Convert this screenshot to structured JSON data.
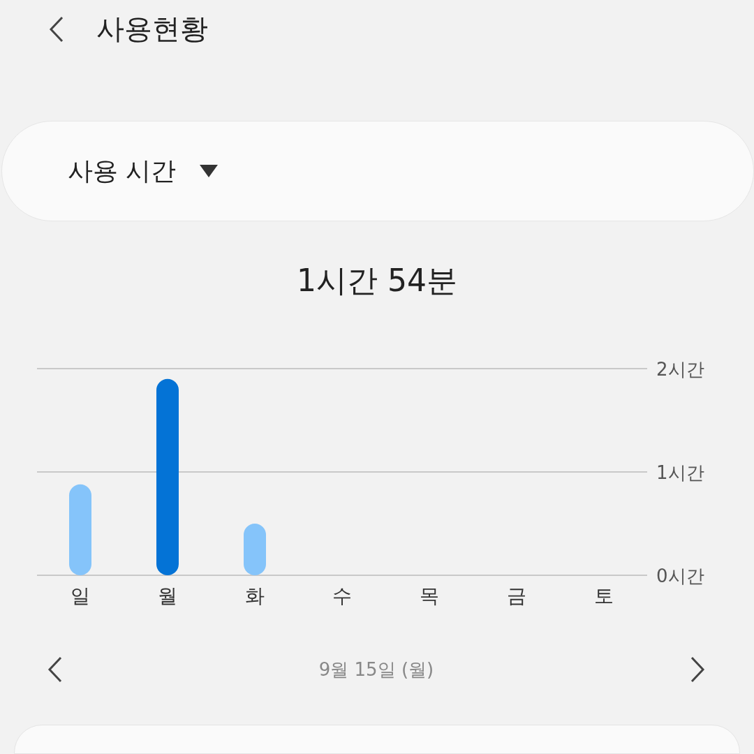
{
  "header": {
    "title": "사용현황"
  },
  "selector": {
    "label": "사용 시간"
  },
  "total": "1시간 54분",
  "chart_data": {
    "type": "bar",
    "categories": [
      "일",
      "월",
      "화",
      "수",
      "목",
      "금",
      "토"
    ],
    "stacked": true,
    "ylim": [
      0,
      2
    ],
    "series": [
      {
        "color": "#85c4fa",
        "values": [
          0.88,
          null,
          0.5,
          null,
          null,
          null,
          null
        ]
      },
      {
        "color": "#0473d6",
        "values": [
          null,
          1.9,
          null,
          null,
          null,
          null,
          null
        ]
      }
    ],
    "yticks": [
      {
        "value": 0,
        "label": "0시간"
      },
      {
        "value": 1,
        "label": "1시간"
      },
      {
        "value": 2,
        "label": "2시간"
      }
    ]
  },
  "date_nav": {
    "date": "9월 15일 (월)"
  }
}
